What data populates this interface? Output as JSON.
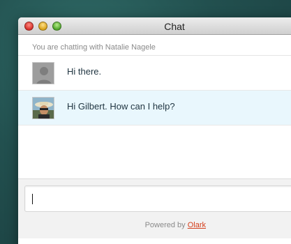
{
  "window": {
    "title": "Chat"
  },
  "chat": {
    "subheader": "You are chatting with Natalie Nagele",
    "messages": [
      {
        "sender": "visitor",
        "avatar": "default-user-avatar",
        "text": "Hi there."
      },
      {
        "sender": "operator",
        "avatar": "operator-photo-avatar",
        "text": "Hi Gilbert. How can I help?"
      }
    ]
  },
  "composer": {
    "input_value": "",
    "powered_by_text": "Powered by",
    "brand_link": "Olark"
  },
  "colors": {
    "highlight_row": "#e9f7fd",
    "brand_link": "#d43f1c"
  }
}
